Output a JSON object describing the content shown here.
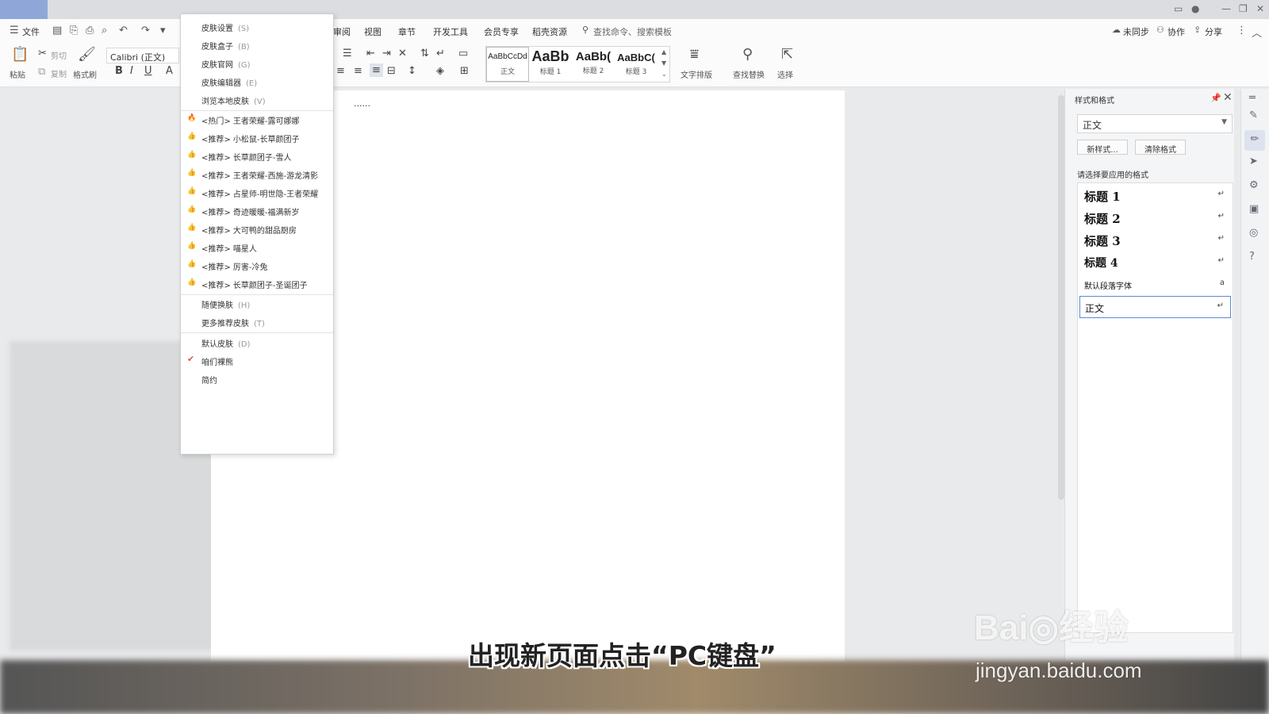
{
  "menubar": {
    "file_label": "文件",
    "tabs": [
      "审阅",
      "视图",
      "章节",
      "开发工具",
      "会员专享",
      "稻壳资源"
    ],
    "search_placeholder": "查找命令、搜索模板",
    "sync_label": "未同步",
    "collab_label": "协作",
    "share_label": "分享"
  },
  "toolbar": {
    "paste_label": "粘贴",
    "cut_label": "剪切",
    "copy_label": "复制",
    "format_painter_label": "格式刷",
    "font_name": "Calibri (正文)",
    "styles": [
      {
        "sample": "AaBbCcDd",
        "caption": "正文"
      },
      {
        "sample": "AaBb",
        "caption": "标题 1"
      },
      {
        "sample": "AaBb(",
        "caption": "标题 2"
      },
      {
        "sample": "AaBbC(",
        "caption": "标题 3"
      }
    ],
    "text_layout_label": "文字排版",
    "find_replace_label": "查找替换",
    "select_label": "选择"
  },
  "skin_menu": {
    "top_items": [
      {
        "label": "皮肤设置",
        "key": "(S)"
      },
      {
        "label": "皮肤盒子",
        "key": "(B)"
      },
      {
        "label": "皮肤官网",
        "key": "(G)"
      },
      {
        "label": "皮肤编辑器",
        "key": "(E)"
      },
      {
        "label": "浏览本地皮肤",
        "key": "(V)"
      }
    ],
    "skins": [
      "<热门> 王者荣耀-露可娜娜",
      "<推荐> 小松鼠-长草颜团子",
      "<推荐> 长草颜团子-雪人",
      "<推荐> 王者荣耀-西施-游龙清影",
      "<推荐> 占星师-明世隐-王者荣耀",
      "<推荐> 奇迹暖暖-福满新岁",
      "<推荐> 大可鸭的甜品厨房",
      "<推荐> 喵星人",
      "<推荐> 厉害-冷兔",
      "<推荐> 长草颜团子-圣诞团子"
    ],
    "mid_items": [
      {
        "label": "随便换肤",
        "key": "(H)"
      },
      {
        "label": "更多推荐皮肤",
        "key": "(T)"
      }
    ],
    "bottom_items": [
      {
        "label": "默认皮肤",
        "key": "(D)",
        "checked": false
      },
      {
        "label": "咱们裸熊",
        "key": "",
        "checked": true
      },
      {
        "label": "简约",
        "key": "",
        "checked": false
      }
    ]
  },
  "document": {
    "text": "......"
  },
  "side_panel": {
    "title": "样式和格式",
    "current_style": "正文",
    "new_style_button": "新样式...",
    "clear_format_button": "清除格式",
    "apply_label": "请选择要应用的格式",
    "styles": [
      {
        "name": "标题  1",
        "marker": "↵"
      },
      {
        "name": "标题  2",
        "marker": "↵"
      },
      {
        "name": "标题  3",
        "marker": "↵"
      },
      {
        "name": "标题  4",
        "marker": "↵"
      },
      {
        "name": "默认段落字体",
        "marker": "a"
      },
      {
        "name": "正文",
        "marker": "↵"
      }
    ]
  },
  "subtitle": "出现新页面点击“PC键盘”",
  "watermark": {
    "logo": "Bai◎经验",
    "url": "jingyan.baidu.com"
  },
  "colors": {
    "accent": "#5b8ad6",
    "hot_icon": "#e05a4b",
    "recommend_icon": "#e8a04a"
  }
}
